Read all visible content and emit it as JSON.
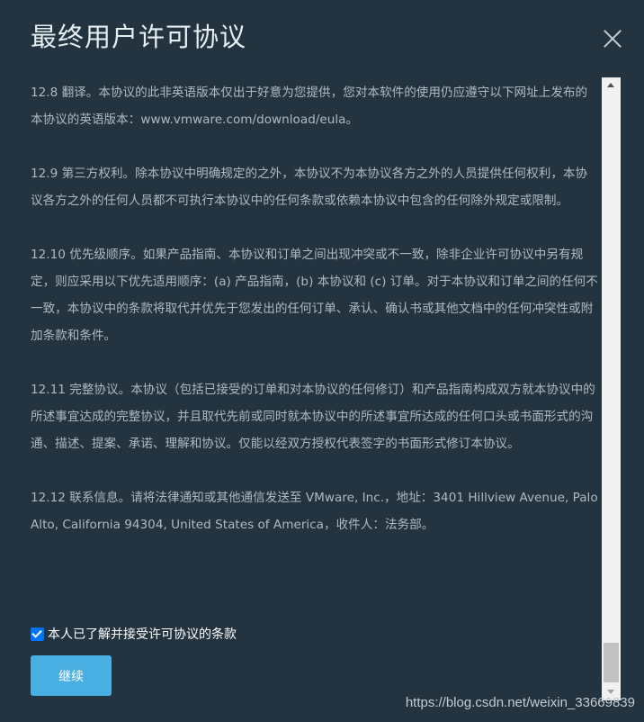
{
  "dialog": {
    "title": "最终用户许可协议",
    "close_icon": "close-icon"
  },
  "content": {
    "paragraphs": [
      "12.8 翻译。本协议的此非英语版本仅出于好意为您提供，您对本软件的使用仍应遵守以下网址上发布的本协议的英语版本：www.vmware.com/download/eula。",
      "12.9 第三方权利。除本协议中明确规定的之外，本协议不为本协议各方之外的人员提供任何权利，本协议各方之外的任何人员都不可执行本协议中的任何条款或依赖本协议中包含的任何除外规定或限制。",
      "12.10 优先级顺序。如果产品指南、本协议和订单之间出现冲突或不一致，除非企业许可协议中另有规定，则应采用以下优先适用顺序：(a) 产品指南，(b) 本协议和 (c) 订单。对于本协议和订单之间的任何不一致，本协议中的条款将取代并优先于您发出的任何订单、承认、确认书或其他文档中的任何冲突性或附加条款和条件。",
      "12.11 完整协议。本协议（包括已接受的订单和对本协议的任何修订）和产品指南构成双方就本协议中的所述事宜达成的完整协议，并且取代先前或同时就本协议中的所述事宜所达成的任何口头或书面形式的沟通、描述、提案、承诺、理解和协议。仅能以经双方授权代表签字的书面形式修订本协议。",
      "12.12 联系信息。请将法律通知或其他通信发送至 VMware, Inc.，地址：3401 Hillview Avenue, Palo Alto, California 94304, United States of America，收件人：法务部。"
    ]
  },
  "accept": {
    "label": "本人已了解并接受许可协议的条款",
    "checked": true
  },
  "continue_button": {
    "label": "继续"
  },
  "watermark": {
    "text": "https://blog.csdn.net/weixin_33669839"
  },
  "colors": {
    "background": "#233440",
    "button": "#49aee2",
    "text": "#aebac1"
  }
}
